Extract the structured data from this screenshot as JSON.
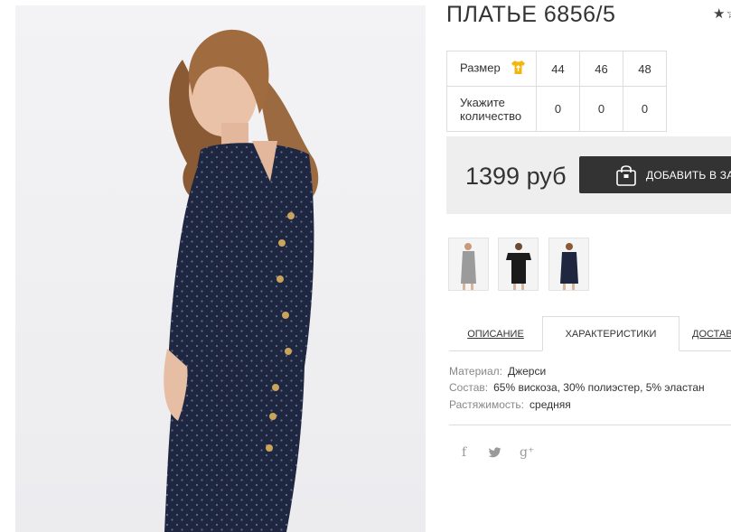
{
  "product": {
    "title": "ПЛАТЬЕ 6856/5",
    "rating_stars": "★☆"
  },
  "size_table": {
    "size_label": "Размер",
    "qty_label": "Укажите количество",
    "sizes": [
      "44",
      "46",
      "48"
    ],
    "quantities": [
      "0",
      "0",
      "0"
    ]
  },
  "purchase": {
    "price": "1399 руб",
    "add_to_cart": "ДОБАВИТЬ В ЗАКАЗ"
  },
  "tabs": {
    "description": "ОПИСАНИЕ",
    "characteristics": "ХАРАКТЕРИСТИКИ",
    "delivery": "ДОСТАВКА"
  },
  "specs": {
    "material_label": "Материал:",
    "material_value": "Джерси",
    "composition_label": "Состав:",
    "composition_value": "65% вискоза, 30% полиэстер, 5% эластан",
    "stretch_label": "Растяжимость:",
    "stretch_value": "средняя"
  },
  "social": {
    "facebook": "f",
    "twitter": "🐦",
    "google_plus": "g⁺"
  },
  "colors": {
    "dress": "#1f2740",
    "button": "#333333",
    "price_bg": "#eeeeee",
    "shirt_icon": "#f2b70f"
  }
}
